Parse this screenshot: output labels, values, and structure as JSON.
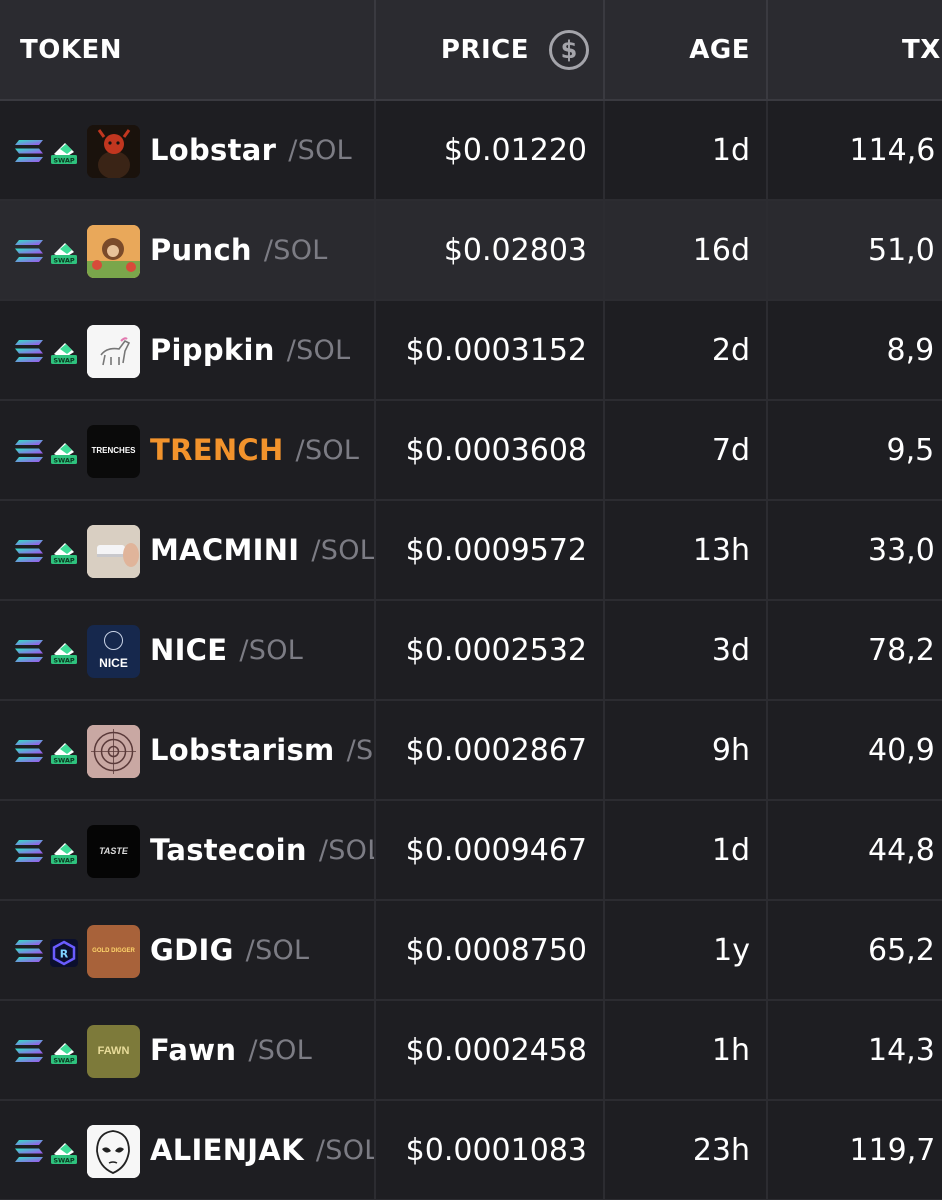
{
  "header": {
    "token_label": "TOKEN",
    "price_label": "PRICE",
    "price_icon": "dollar-circle-icon",
    "age_label": "AGE",
    "txns_label": "TXI"
  },
  "colors": {
    "background": "#1e1e22",
    "row_alt": "#2a2a2f",
    "header_bg": "#2b2b30",
    "quote": "#7c7c84",
    "highlight_name": "#f2932c"
  },
  "rows": [
    {
      "name": "Lobstar",
      "quote": "/SOL",
      "price": "$0.01220",
      "age": "1d",
      "txns": "114,6",
      "dex": "swap-icon",
      "avatar_icon": "lobster-avatar-icon"
    },
    {
      "name": "Punch",
      "quote": "/SOL",
      "price": "$0.02803",
      "age": "16d",
      "txns": "51,0",
      "dex": "swap-icon",
      "avatar_icon": "monkey-avatar-icon"
    },
    {
      "name": "Pippkin",
      "quote": "/SOL",
      "price": "$0.0003152",
      "age": "2d",
      "txns": "8,9",
      "dex": "swap-icon",
      "avatar_icon": "horse-avatar-icon"
    },
    {
      "name": "TRENCH",
      "quote": "/SOL",
      "price": "$0.0003608",
      "age": "7d",
      "txns": "9,5",
      "dex": "swap-icon",
      "avatar_text": "TRENCHES"
    },
    {
      "name": "MACMINI",
      "quote": "/SOL",
      "price": "$0.0009572",
      "age": "13h",
      "txns": "33,0",
      "dex": "swap-icon",
      "avatar_icon": "mac-mini-avatar-icon"
    },
    {
      "name": "NICE",
      "quote": "/SOL",
      "price": "$0.0002532",
      "age": "3d",
      "txns": "78,2",
      "dex": "swap-icon",
      "avatar_text": "NICE"
    },
    {
      "name": "Lobstarism",
      "quote": "/SOL",
      "price": "$0.0002867",
      "age": "9h",
      "txns": "40,9",
      "dex": "swap-icon",
      "avatar_icon": "mandala-avatar-icon"
    },
    {
      "name": "Tastecoin",
      "quote": "/SOL",
      "price": "$0.0009467",
      "age": "1d",
      "txns": "44,8",
      "dex": "swap-icon",
      "avatar_text": "TASTE"
    },
    {
      "name": "GDIG",
      "quote": "/SOL",
      "price": "$0.0008750",
      "age": "1y",
      "txns": "65,2",
      "dex": "raydium-icon",
      "avatar_text": "GOLD DIGGER"
    },
    {
      "name": "Fawn",
      "quote": "/SOL",
      "price": "$0.0002458",
      "age": "1h",
      "txns": "14,3",
      "dex": "swap-icon",
      "avatar_text": "FAWN"
    },
    {
      "name": "ALIENJAK",
      "quote": "/SOL",
      "price": "$0.0001083",
      "age": "23h",
      "txns": "119,7",
      "dex": "swap-icon",
      "avatar_icon": "alien-face-avatar-icon"
    }
  ]
}
